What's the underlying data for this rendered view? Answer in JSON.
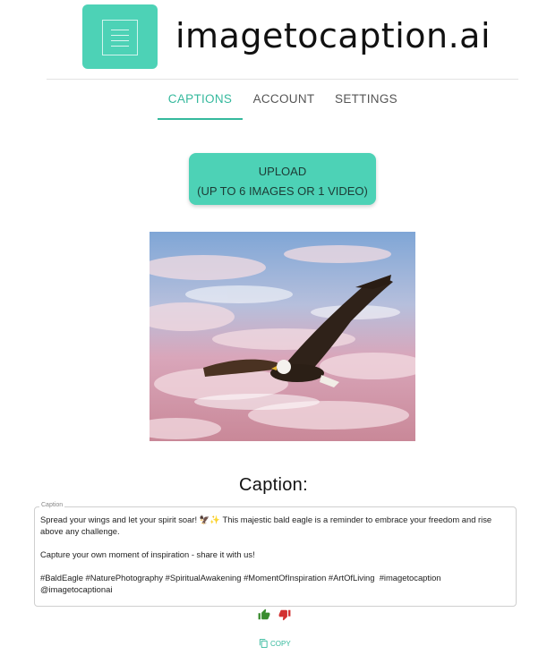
{
  "brand": {
    "name": "imagetocaption.ai",
    "accent": "#4dd2b6",
    "logo_icon": "document-icon"
  },
  "tabs": [
    {
      "label": "CAPTIONS",
      "active": true
    },
    {
      "label": "ACCOUNT",
      "active": false
    },
    {
      "label": "SETTINGS",
      "active": false
    }
  ],
  "upload": {
    "line1": "UPLOAD",
    "line2": "(UP TO 6 IMAGES OR 1 VIDEO)"
  },
  "image": {
    "subject": "bald eagle soaring in pink sky"
  },
  "caption": {
    "heading": "Caption:",
    "field_label": "Caption",
    "text": "Spread your wings and let your spirit soar! 🦅✨ This majestic bald eagle is a reminder to embrace your freedom and rise above any challenge.\n\nCapture your own moment of inspiration - share it with us!\n\n#BaldEagle #NaturePhotography #SpiritualAwakening #MomentOfInspiration #ArtOfLiving  #imagetocaption @imagetocaptionai"
  },
  "feedback": {
    "up_icon": "thumbs-up-icon",
    "down_icon": "thumbs-down-icon",
    "up_color": "#3a8c2f",
    "down_color": "#d32f2f"
  },
  "copy": {
    "label": "COPY",
    "icon": "copy-icon"
  }
}
